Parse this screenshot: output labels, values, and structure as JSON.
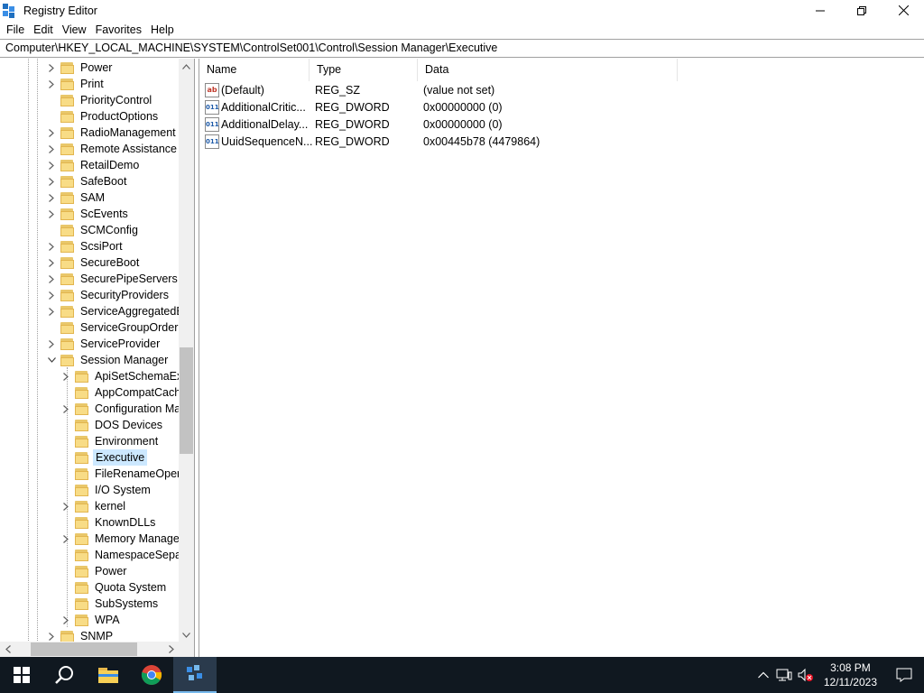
{
  "window": {
    "title": "Registry Editor",
    "minimize_glyph": "—",
    "restore_glyph": "❐",
    "close_glyph": "✕"
  },
  "menu": [
    "File",
    "Edit",
    "View",
    "Favorites",
    "Help"
  ],
  "address": "Computer\\HKEY_LOCAL_MACHINE\\SYSTEM\\ControlSet001\\Control\\Session Manager\\Executive",
  "tree": [
    {
      "label": "Power",
      "level": 0,
      "expander": "collapsed"
    },
    {
      "label": "Print",
      "level": 0,
      "expander": "collapsed"
    },
    {
      "label": "PriorityControl",
      "level": 0,
      "expander": "none"
    },
    {
      "label": "ProductOptions",
      "level": 0,
      "expander": "none"
    },
    {
      "label": "RadioManagement",
      "level": 0,
      "expander": "collapsed"
    },
    {
      "label": "Remote Assistance",
      "level": 0,
      "expander": "collapsed"
    },
    {
      "label": "RetailDemo",
      "level": 0,
      "expander": "collapsed"
    },
    {
      "label": "SafeBoot",
      "level": 0,
      "expander": "collapsed"
    },
    {
      "label": "SAM",
      "level": 0,
      "expander": "collapsed"
    },
    {
      "label": "ScEvents",
      "level": 0,
      "expander": "collapsed"
    },
    {
      "label": "SCMConfig",
      "level": 0,
      "expander": "none"
    },
    {
      "label": "ScsiPort",
      "level": 0,
      "expander": "collapsed"
    },
    {
      "label": "SecureBoot",
      "level": 0,
      "expander": "collapsed"
    },
    {
      "label": "SecurePipeServers",
      "level": 0,
      "expander": "collapsed"
    },
    {
      "label": "SecurityProviders",
      "level": 0,
      "expander": "collapsed"
    },
    {
      "label": "ServiceAggregatedEv",
      "level": 0,
      "expander": "collapsed"
    },
    {
      "label": "ServiceGroupOrder",
      "level": 0,
      "expander": "none"
    },
    {
      "label": "ServiceProvider",
      "level": 0,
      "expander": "collapsed"
    },
    {
      "label": "Session Manager",
      "level": 0,
      "expander": "expanded"
    },
    {
      "label": "ApiSetSchemaExte",
      "level": 1,
      "expander": "collapsed"
    },
    {
      "label": "AppCompatCache",
      "level": 1,
      "expander": "none"
    },
    {
      "label": "Configuration Ma",
      "level": 1,
      "expander": "collapsed"
    },
    {
      "label": "DOS Devices",
      "level": 1,
      "expander": "none"
    },
    {
      "label": "Environment",
      "level": 1,
      "expander": "none"
    },
    {
      "label": "Executive",
      "level": 1,
      "expander": "none",
      "selected": true
    },
    {
      "label": "FileRenameOpera",
      "level": 1,
      "expander": "none"
    },
    {
      "label": "I/O System",
      "level": 1,
      "expander": "none"
    },
    {
      "label": "kernel",
      "level": 1,
      "expander": "collapsed"
    },
    {
      "label": "KnownDLLs",
      "level": 1,
      "expander": "none"
    },
    {
      "label": "Memory Manager",
      "level": 1,
      "expander": "collapsed"
    },
    {
      "label": "NamespaceSepara",
      "level": 1,
      "expander": "none"
    },
    {
      "label": "Power",
      "level": 1,
      "expander": "none"
    },
    {
      "label": "Quota System",
      "level": 1,
      "expander": "none"
    },
    {
      "label": "SubSystems",
      "level": 1,
      "expander": "none"
    },
    {
      "label": "WPA",
      "level": 1,
      "expander": "collapsed"
    },
    {
      "label": "SNMP",
      "level": 0,
      "expander": "collapsed"
    }
  ],
  "columns": {
    "name": "Name",
    "type": "Type",
    "data": "Data"
  },
  "values": [
    {
      "icon": "string-value-icon",
      "icon_text": "ab",
      "name": "(Default)",
      "type": "REG_SZ",
      "data": "(value not set)"
    },
    {
      "icon": "binary-value-icon",
      "icon_text": "011",
      "name": "AdditionalCritic...",
      "type": "REG_DWORD",
      "data": "0x00000000 (0)"
    },
    {
      "icon": "binary-value-icon",
      "icon_text": "011",
      "name": "AdditionalDelay...",
      "type": "REG_DWORD",
      "data": "0x00000000 (0)"
    },
    {
      "icon": "binary-value-icon",
      "icon_text": "011",
      "name": "UuidSequenceN...",
      "type": "REG_DWORD",
      "data": "0x00445b78 (4479864)"
    }
  ],
  "taskbar": {
    "clock_time": "3:08 PM",
    "clock_date": "12/11/2023"
  },
  "colors": {
    "selection": "#cce8ff",
    "taskbar": "#101820",
    "folder": "#f8dc86"
  }
}
